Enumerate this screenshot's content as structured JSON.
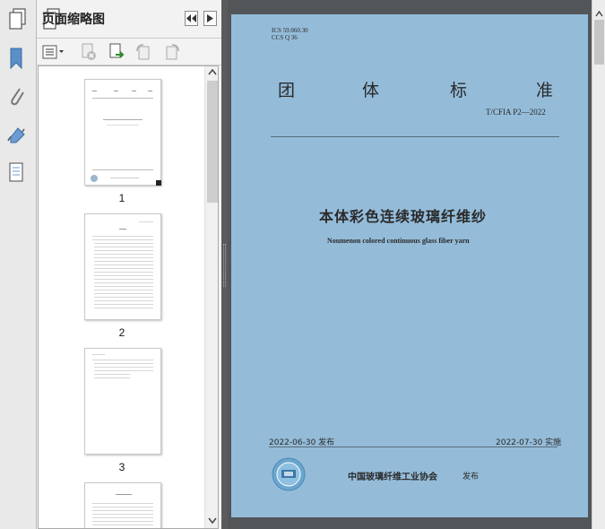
{
  "panel": {
    "title": "页面缩略图"
  },
  "thumbnails": [
    {
      "number": "1"
    },
    {
      "number": "2"
    },
    {
      "number": "3"
    }
  ],
  "document": {
    "ics": "ICS 59.060.30",
    "ccs": "CCS Q 36",
    "heading_chars": [
      "团",
      "体",
      "标",
      "准"
    ],
    "standard_no": "T/CFIA P2—2022",
    "title_cn": "本体彩色连续玻璃纤维纱",
    "title_en": "Noumenon colored continuous glass fiber yarn",
    "publish_date": "2022-06-30 发布",
    "effective_date": "2022-07-30 实施",
    "publisher": "中国玻璃纤维工业协会",
    "publish_word": "发布"
  },
  "colors": {
    "page_bg": "#94bcd9",
    "viewer_bg": "#525659"
  }
}
